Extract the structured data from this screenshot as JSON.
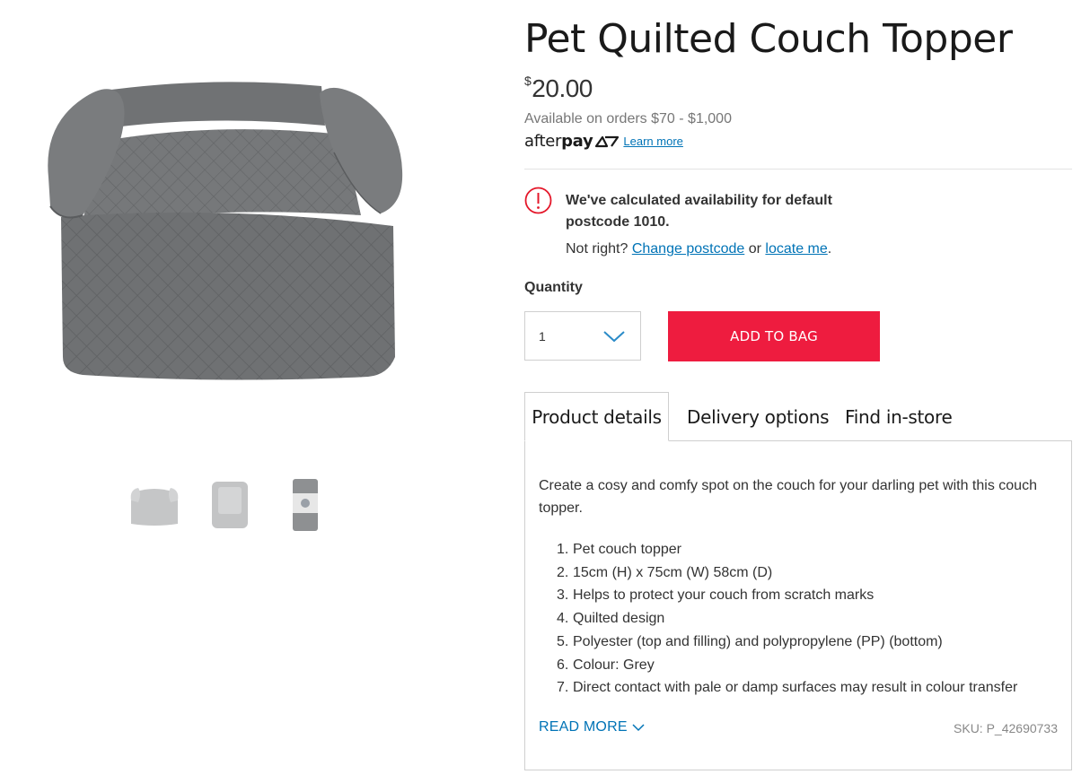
{
  "product": {
    "title": "Pet Quilted Couch Topper",
    "price_currency": "$",
    "price_value": "20.00",
    "sku": "SKU: P_42690733",
    "image_color": "#6c6e70"
  },
  "afterpay": {
    "note": "Available on orders $70 - $1,000",
    "logo_prefix": "after",
    "logo_bold": "pay",
    "learn_more": "Learn more"
  },
  "availability": {
    "message": "We've calculated availability for default postcode 1010.",
    "prefix": "Not right?",
    "change_link": "Change postcode",
    "or_text": "or",
    "locate_link": "locate me",
    "suffix": "."
  },
  "quantity": {
    "label": "Quantity",
    "selected": "1"
  },
  "add_to_bag": "ADD TO BAG",
  "tabs": [
    {
      "label": "Product details",
      "active": true
    },
    {
      "label": "Delivery options",
      "active": false
    },
    {
      "label": "Find in-store",
      "active": false
    }
  ],
  "details": {
    "description": "Create a cosy and comfy spot on the couch for your darling pet with this couch topper.",
    "features": [
      {
        "num": "1.",
        "text": "Pet couch topper"
      },
      {
        "num": "2.",
        "text": "15cm (H) x 75cm (W) 58cm (D)"
      },
      {
        "num": "3.",
        "text": "Helps to protect your couch from scratch marks"
      },
      {
        "num": "4.",
        "text": "Quilted design"
      },
      {
        "num": "5.",
        "text": "Polyester (top and filling) and polypropylene (PP) (bottom)"
      },
      {
        "num": "6.",
        "text": "Colour: Grey"
      },
      {
        "num": "7.",
        "text": "Direct contact with pale or damp surfaces may result in colour transfer"
      }
    ],
    "read_more": "READ MORE"
  },
  "colors": {
    "accent_red": "#ee1c3f",
    "link_blue": "#0073b6",
    "notice_red": "#e4172a"
  },
  "icons": {
    "notice": "exclamation-circle-icon",
    "qty": "chevron-down-icon",
    "read_more": "chevron-down-icon"
  }
}
